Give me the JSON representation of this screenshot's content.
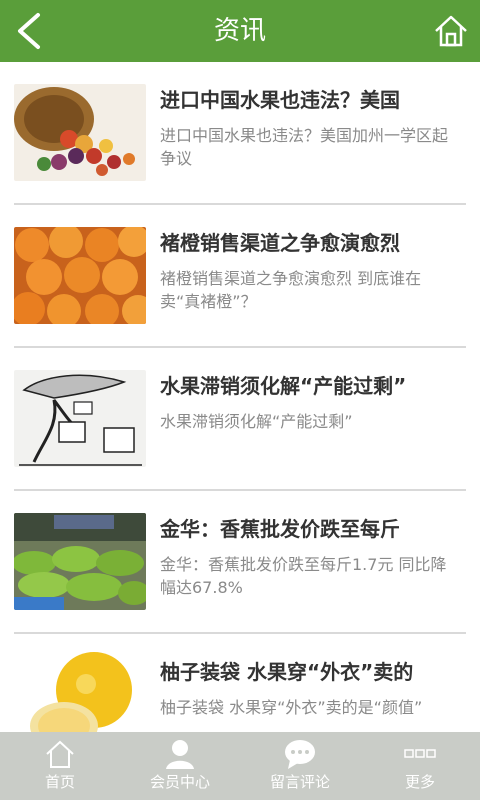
{
  "header": {
    "title": "资讯"
  },
  "articles": [
    {
      "title": "进口中国水果也违法？美国",
      "summary": "进口中国水果也违法？美国加州一学区起争议"
    },
    {
      "title": "褚橙销售渠道之争愈演愈烈",
      "summary": "褚橙销售渠道之争愈演愈烈 到底谁在卖“真褚橙”？"
    },
    {
      "title": "水果滞销须化解“产能过剩”",
      "summary": "水果滞销须化解“产能过剩”"
    },
    {
      "title": "金华：香蕉批发价跌至每斤",
      "summary": "金华：香蕉批发价跌至每斤1.7元 同比降幅达67.8%"
    },
    {
      "title": "柚子装袋 水果穿“外衣”卖的",
      "summary": "柚子装袋 水果穿“外衣”卖的是“颜值”"
    }
  ],
  "tabbar": {
    "items": [
      {
        "label": "首页"
      },
      {
        "label": "会员中心"
      },
      {
        "label": "留言评论"
      },
      {
        "label": "更多"
      }
    ]
  }
}
